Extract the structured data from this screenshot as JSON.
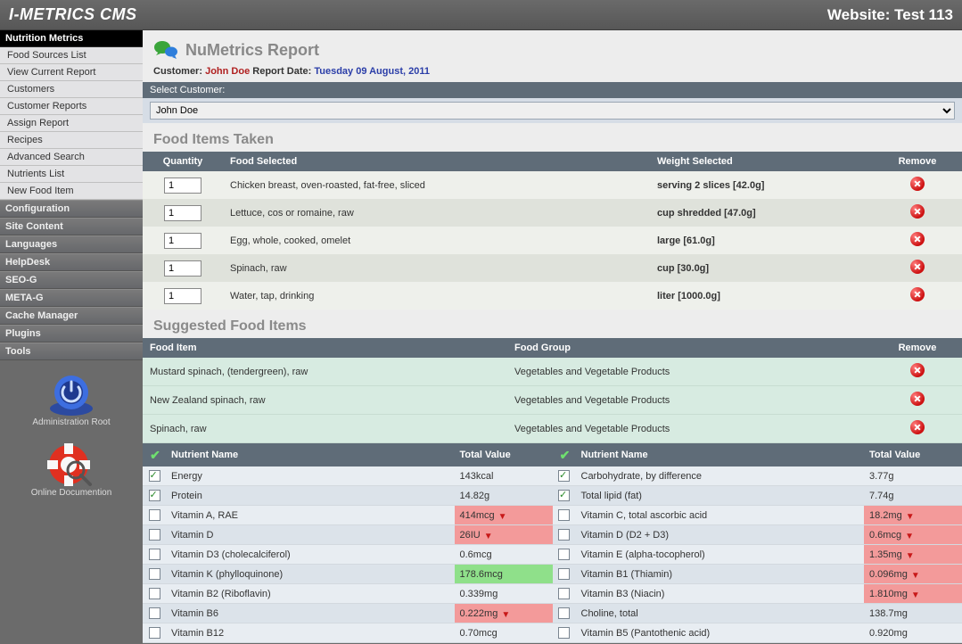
{
  "topbar": {
    "title": "I-METRICS CMS",
    "website": "Website: Test 113"
  },
  "sidebar": {
    "active_header": "Nutrition Metrics",
    "nutrition_items": [
      "Food Sources List",
      "View Current Report",
      "Customers",
      "Customer Reports",
      "Assign Report",
      "Recipes",
      "Advanced Search",
      "Nutrients List",
      "New Food Item"
    ],
    "headers": [
      "Configuration",
      "Site Content",
      "Languages",
      "HelpDesk",
      "SEO-G",
      "META-G",
      "Cache Manager",
      "Plugins",
      "Tools"
    ],
    "buttons": {
      "admin_root": "Administration Root",
      "docs": "Online Documention"
    }
  },
  "page": {
    "title": "NuMetrics Report",
    "meta": {
      "customer_label": "Customer:",
      "customer_name": "John Doe",
      "date_label": "Report Date:",
      "date_value": "Tuesday 09 August, 2011"
    },
    "selector": {
      "label": "Select Customer:",
      "value": "John Doe"
    },
    "sections": {
      "taken": "Food Items Taken",
      "suggested": "Suggested Food Items"
    },
    "taken_headers": {
      "qty": "Quantity",
      "food": "Food Selected",
      "weight": "Weight Selected",
      "remove": "Remove"
    },
    "taken_rows": [
      {
        "qty": "1",
        "food": "Chicken breast, oven-roasted, fat-free, sliced",
        "weight": "serving 2 slices [42.0g]"
      },
      {
        "qty": "1",
        "food": "Lettuce, cos or romaine, raw",
        "weight": "cup shredded [47.0g]"
      },
      {
        "qty": "1",
        "food": "Egg, whole, cooked, omelet",
        "weight": "large [61.0g]"
      },
      {
        "qty": "1",
        "food": "Spinach, raw",
        "weight": "cup [30.0g]"
      },
      {
        "qty": "1",
        "food": "Water, tap, drinking",
        "weight": "liter [1000.0g]"
      }
    ],
    "suggested_headers": {
      "item": "Food Item",
      "group": "Food Group",
      "remove": "Remove"
    },
    "suggested_rows": [
      {
        "item": "Mustard spinach, (tendergreen), raw",
        "group": "Vegetables and Vegetable Products"
      },
      {
        "item": "New Zealand spinach, raw",
        "group": "Vegetables and Vegetable Products"
      },
      {
        "item": "Spinach, raw",
        "group": "Vegetables and Vegetable Products"
      }
    ],
    "nut_headers": {
      "name": "Nutrient Name",
      "value": "Total Value"
    },
    "nutrients_left": [
      {
        "c": true,
        "name": "Energy",
        "value": "143kcal",
        "state": ""
      },
      {
        "c": true,
        "name": "Protein",
        "value": "14.82g",
        "state": ""
      },
      {
        "c": false,
        "name": "Vitamin A, RAE",
        "value": "414mcg",
        "state": "bad"
      },
      {
        "c": false,
        "name": "Vitamin D",
        "value": "26IU",
        "state": "bad"
      },
      {
        "c": false,
        "name": "Vitamin D3 (cholecalciferol)",
        "value": "0.6mcg",
        "state": ""
      },
      {
        "c": false,
        "name": "Vitamin K (phylloquinone)",
        "value": "178.6mcg",
        "state": "good"
      },
      {
        "c": false,
        "name": "Vitamin B2 (Riboflavin)",
        "value": "0.339mg",
        "state": ""
      },
      {
        "c": false,
        "name": "Vitamin B6",
        "value": "0.222mg",
        "state": "bad"
      },
      {
        "c": false,
        "name": "Vitamin B12",
        "value": "0.70mcg",
        "state": ""
      }
    ],
    "nutrients_right": [
      {
        "c": true,
        "name": "Carbohydrate, by difference",
        "value": "3.77g",
        "state": ""
      },
      {
        "c": true,
        "name": "Total lipid (fat)",
        "value": "7.74g",
        "state": ""
      },
      {
        "c": false,
        "name": "Vitamin C, total ascorbic acid",
        "value": "18.2mg",
        "state": "bad"
      },
      {
        "c": false,
        "name": "Vitamin D (D2 + D3)",
        "value": "0.6mcg",
        "state": "bad"
      },
      {
        "c": false,
        "name": "Vitamin E (alpha-tocopherol)",
        "value": "1.35mg",
        "state": "bad"
      },
      {
        "c": false,
        "name": "Vitamin B1 (Thiamin)",
        "value": "0.096mg",
        "state": "bad"
      },
      {
        "c": false,
        "name": "Vitamin B3 (Niacin)",
        "value": "1.810mg",
        "state": "bad"
      },
      {
        "c": false,
        "name": "Choline, total",
        "value": "138.7mg",
        "state": ""
      },
      {
        "c": false,
        "name": "Vitamin B5 (Pantothenic acid)",
        "value": "0.920mg",
        "state": ""
      }
    ]
  }
}
